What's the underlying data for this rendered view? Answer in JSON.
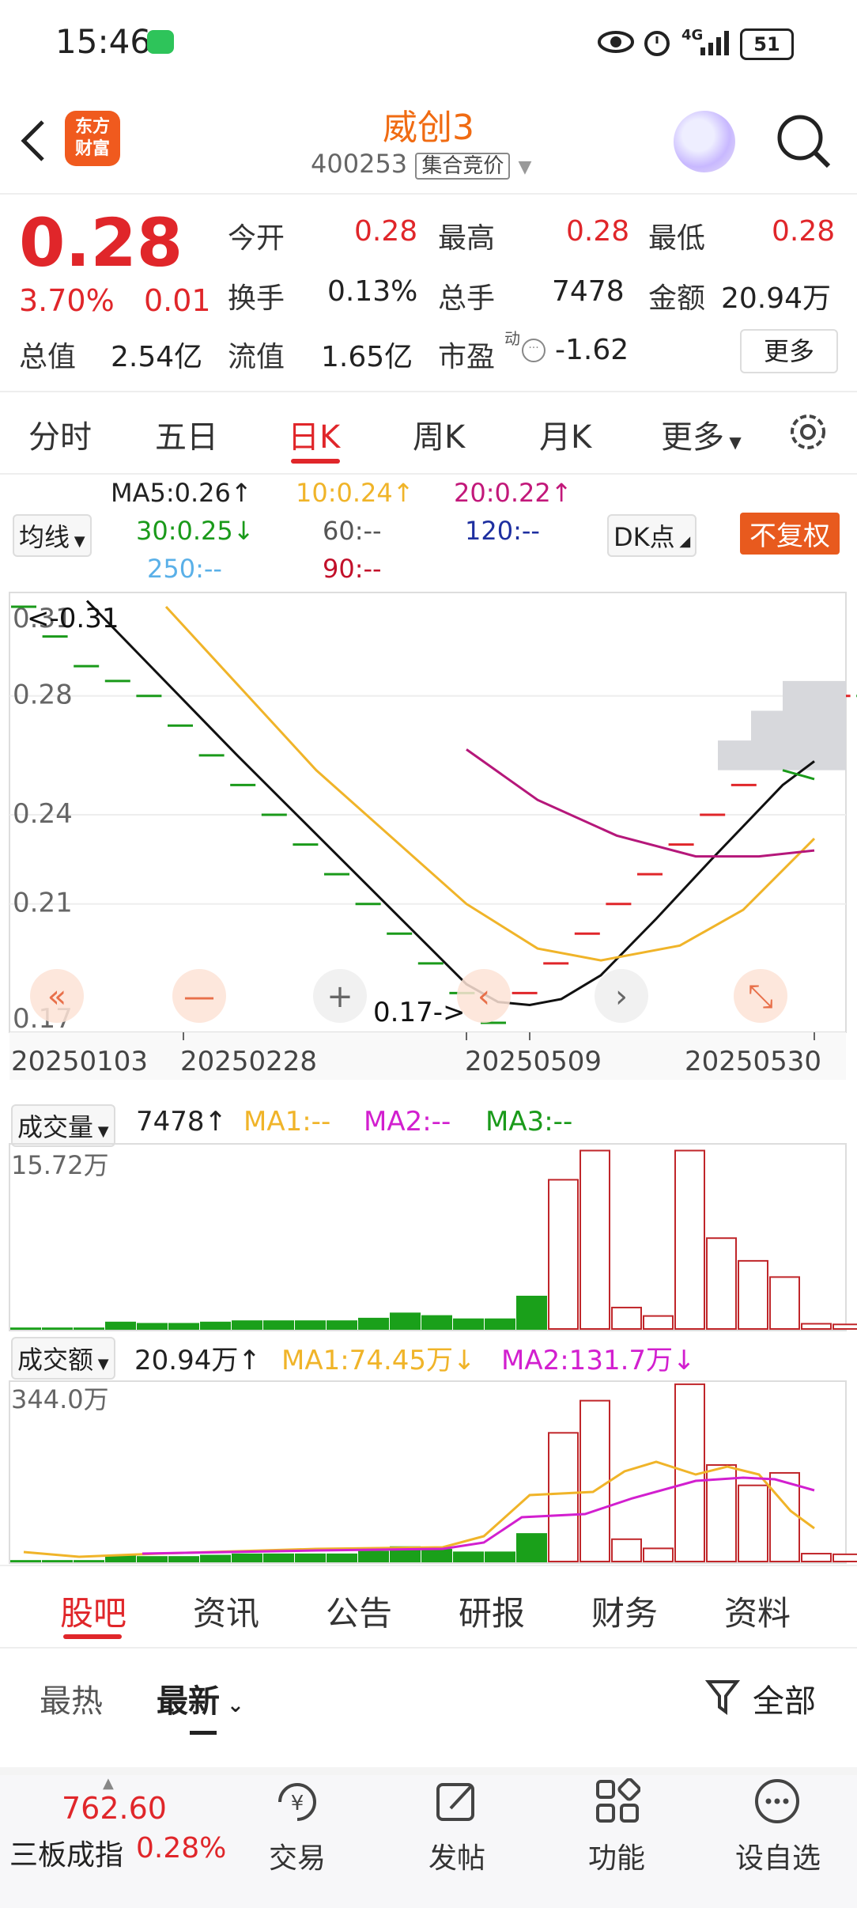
{
  "status_bar": {
    "time": "15:46",
    "network": "4G",
    "battery": "51"
  },
  "header": {
    "title": "威创3",
    "code": "400253",
    "tag": "集合竞价",
    "logo_text_1": "东方",
    "logo_text_2": "财富"
  },
  "quote": {
    "price": "0.28",
    "change_pct": "3.70%",
    "change": "0.01",
    "fields": [
      {
        "label": "今开",
        "value": "0.28"
      },
      {
        "label": "最高",
        "value": "0.28"
      },
      {
        "label": "最低",
        "value": "0.28"
      },
      {
        "label": "换手",
        "value": "0.13%"
      },
      {
        "label": "总手",
        "value": "7478"
      },
      {
        "label": "金额",
        "value": "20.94万"
      },
      {
        "label": "总值",
        "value": "2.54亿"
      },
      {
        "label": "流值",
        "value": "1.65亿"
      },
      {
        "label": "市盈",
        "value": "-1.62"
      }
    ],
    "pe_sup": "动",
    "more": "更多"
  },
  "period_tabs": [
    "分时",
    "五日",
    "日K",
    "周K",
    "月K",
    "更多"
  ],
  "ma_panel": {
    "dropdown": "均线",
    "ma5": "MA5:0.26↑",
    "ma10": "10:0.24↑",
    "ma20": "20:0.22↑",
    "ma30": "30:0.25↓",
    "ma60": "60:--",
    "ma120": "120:--",
    "ma250": "250:--",
    "ma90": "90:--",
    "dk": "DK点",
    "fq": "不复权"
  },
  "kline": {
    "y_ticks": [
      "0.31",
      "0.28",
      "0.24",
      "0.21",
      "0.17"
    ],
    "x_ticks": [
      "20250103",
      "20250228",
      "20250509",
      "20250530"
    ],
    "high_marker": "<-0.31",
    "low_marker": "0.17->"
  },
  "volume": {
    "dropdown": "成交量",
    "value": "7478↑",
    "ma1": "MA1:--",
    "ma2": "MA2:--",
    "ma3": "MA3:--",
    "max": "15.72万"
  },
  "amount": {
    "dropdown": "成交额",
    "value": "20.94万↑",
    "ma1": "MA1:74.45万↓",
    "ma2": "MA2:131.7万↓",
    "max": "344.0万"
  },
  "content_tabs": [
    "股吧",
    "资讯",
    "公告",
    "研报",
    "财务",
    "资料"
  ],
  "sort": {
    "hot": "最热",
    "new": "最新",
    "filter": "全部"
  },
  "bottom_nav": {
    "index_value": "762.60",
    "index_name": "三板成指",
    "index_pct": "0.28%",
    "items": [
      "交易",
      "发帖",
      "功能",
      "设自选"
    ]
  },
  "chart_data": {
    "type": "bar",
    "note_series": "K-line daily candles (flat single-price days) and volume",
    "kline_prices": [
      0.31,
      0.3,
      0.29,
      0.285,
      0.28,
      0.27,
      0.26,
      0.25,
      0.24,
      0.23,
      0.22,
      0.21,
      0.2,
      0.19,
      0.18,
      0.17,
      0.18,
      0.19,
      0.2,
      0.21,
      0.22,
      0.23,
      0.24,
      0.25,
      0.26,
      0.27,
      0.28,
      0.28,
      0.27
    ],
    "ylim": [
      0.17,
      0.31
    ]
  }
}
